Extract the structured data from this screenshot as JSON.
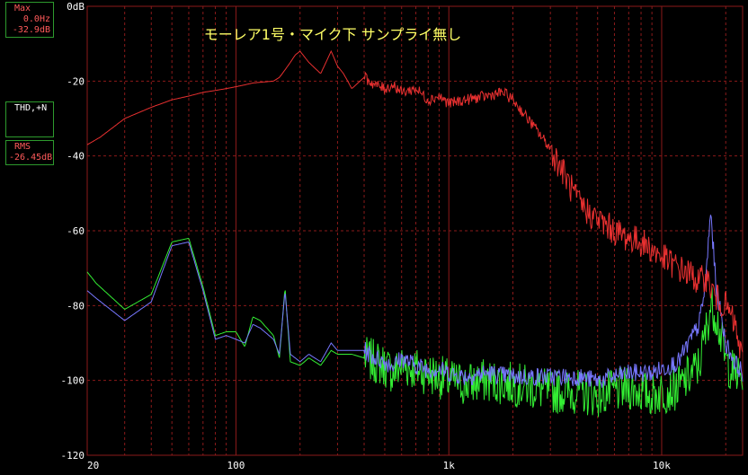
{
  "readouts": {
    "max": {
      "label": "Max",
      "freq": "0.0Hz",
      "level": "-32.9dB"
    },
    "thd": {
      "label": "THD,+N"
    },
    "rms": {
      "label": "RMS",
      "level": "-26.45dB"
    }
  },
  "chart_data": {
    "type": "line",
    "title": "モーレア1号・マイク下 サンプライ無し",
    "xlabel": "",
    "ylabel": "",
    "x_scale": "log",
    "xlim": [
      20,
      24000
    ],
    "ylim": [
      -120,
      0
    ],
    "x_tick_labels": [
      "20",
      "100",
      "1k",
      "10k"
    ],
    "y_tick_labels": [
      "0dB",
      "-20",
      "-40",
      "-60",
      "-80",
      "-100",
      "-120"
    ],
    "grid": true,
    "colors": {
      "background": "#000000",
      "grid": "#8b1a1a",
      "title": "#ffff66",
      "ticks": "#ffffff",
      "readout_border": "#2d9a2d"
    },
    "series": [
      {
        "color": "#e83030",
        "x": [
          20,
          23,
          30,
          40,
          50,
          60,
          70,
          80,
          90,
          100,
          110,
          120,
          150,
          160,
          170,
          180,
          190,
          200,
          220,
          250,
          280,
          300,
          320,
          350,
          400,
          450,
          500,
          550,
          600,
          700,
          800,
          900,
          1000,
          1200,
          1500,
          1800,
          2000,
          2200,
          2500,
          3000,
          3500,
          4000,
          4500,
          5000,
          6000,
          7000,
          8000,
          9000,
          10000,
          12000,
          14000,
          15000,
          16000,
          17000,
          18000,
          20000,
          22000,
          24000
        ],
        "y": [
          -37,
          -35,
          -30,
          -27,
          -25,
          -24,
          -23,
          -22.5,
          -22,
          -21.5,
          -21,
          -20.5,
          -20,
          -19,
          -17,
          -15,
          -13,
          -12,
          -15,
          -18,
          -12,
          -16,
          -18,
          -22,
          -19,
          -21,
          -22,
          -21,
          -23,
          -22,
          -25,
          -24,
          -26,
          -25,
          -24,
          -23,
          -25,
          -28,
          -32,
          -38,
          -45,
          -52,
          -55,
          -57,
          -60,
          -62,
          -63,
          -65,
          -67,
          -70,
          -72,
          -74,
          -72,
          -75,
          -78,
          -80,
          -85,
          -95
        ]
      },
      {
        "color": "#33ee33",
        "x": [
          20,
          22,
          30,
          40,
          50,
          60,
          70,
          80,
          90,
          100,
          110,
          120,
          130,
          150,
          160,
          170,
          180,
          200,
          220,
          250,
          280,
          300,
          350,
          400,
          450,
          500,
          550,
          600,
          700,
          800,
          900,
          1000,
          1200,
          1500,
          2000,
          2500,
          3000,
          4000,
          5000,
          6000,
          7000,
          8000,
          9000,
          10000,
          12000,
          15000,
          16000,
          17000,
          18000,
          20000,
          22000,
          24000
        ],
        "y": [
          -71,
          -74,
          -81,
          -77,
          -63,
          -62,
          -75,
          -88,
          -87,
          -87,
          -91,
          -83,
          -84,
          -88,
          -94,
          -75,
          -95,
          -96,
          -94,
          -96,
          -92,
          -93,
          -93,
          -94,
          -95,
          -96,
          -98,
          -96,
          -97,
          -98,
          -99,
          -100,
          -101,
          -100,
          -101,
          -102,
          -103,
          -103,
          -104,
          -103,
          -102,
          -103,
          -104,
          -103,
          -102,
          -96,
          -88,
          -80,
          -82,
          -95,
          -98,
          -100
        ]
      },
      {
        "color": "#7777ff",
        "x": [
          20,
          22,
          30,
          40,
          50,
          60,
          70,
          80,
          90,
          100,
          110,
          120,
          130,
          150,
          160,
          170,
          180,
          200,
          220,
          250,
          280,
          300,
          350,
          400,
          450,
          500,
          550,
          600,
          700,
          800,
          900,
          1000,
          1200,
          1500,
          2000,
          2500,
          3000,
          4000,
          5000,
          6000,
          7000,
          8000,
          9000,
          10000,
          12000,
          15000,
          16000,
          17000,
          18000,
          20000,
          22000,
          24000
        ],
        "y": [
          -76,
          -78,
          -84,
          -79,
          -64,
          -63,
          -76,
          -89,
          -88,
          -89,
          -90,
          -85,
          -86,
          -89,
          -93,
          -76,
          -93,
          -95,
          -93,
          -95,
          -90,
          -92,
          -92,
          -92,
          -94,
          -95,
          -96,
          -94,
          -96,
          -97,
          -97,
          -98,
          -99,
          -98,
          -99,
          -99,
          -99,
          -99,
          -100,
          -99,
          -98,
          -98,
          -98,
          -97,
          -95,
          -85,
          -75,
          -55,
          -75,
          -90,
          -95,
          -98
        ]
      }
    ]
  }
}
